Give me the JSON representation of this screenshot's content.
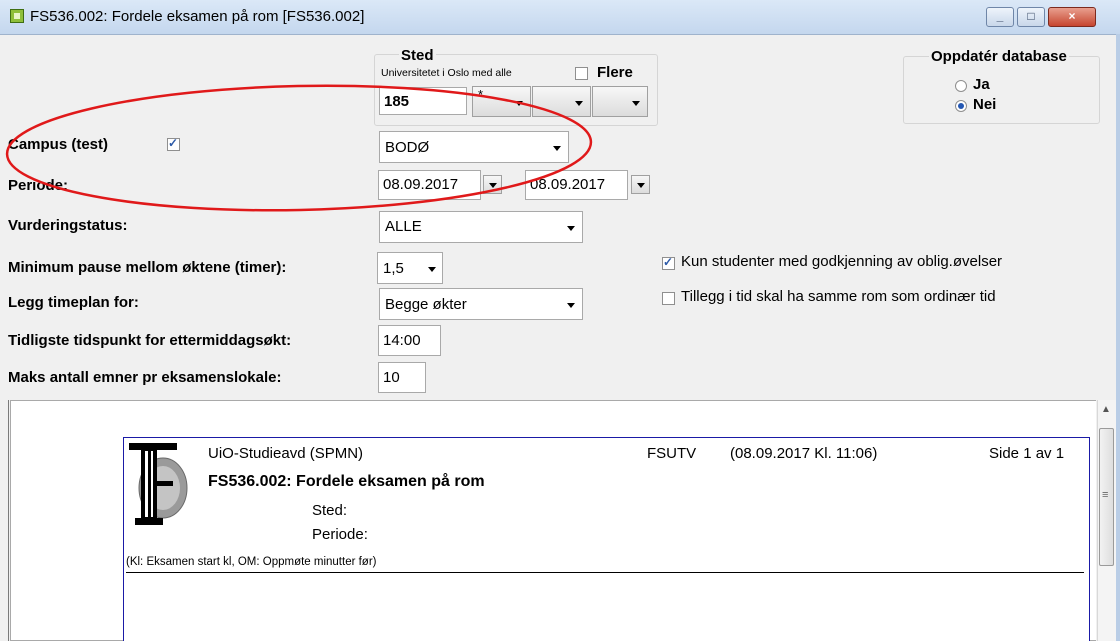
{
  "window": {
    "title": "FS536.002: Fordele eksamen på rom  [FS536.002]"
  },
  "controls": {
    "minimize": "_",
    "maximize": "□",
    "close": "×"
  },
  "sted": {
    "label": "Sted",
    "sublabel": "Universitetet i Oslo med alle",
    "flere_label": "Flere",
    "code": "185",
    "dropdown1": "*"
  },
  "db": {
    "title": "Oppdatér database",
    "ja": "Ja",
    "nei": "Nei",
    "selected": "Nei"
  },
  "form": {
    "campus_label": "Campus (test)",
    "campus_value": "BODØ",
    "periode_label": "Periode:",
    "periode_from": "08.09.2017",
    "periode_to": "08.09.2017",
    "vurdering_label": "Vurderingstatus:",
    "vurdering_value": "ALLE",
    "minpause_label": "Minimum pause mellom øktene (timer):",
    "minpause_value": "1,5",
    "timeplan_label": "Legg timeplan for:",
    "timeplan_value": "Begge økter",
    "tidligste_label": "Tidligste tidspunkt for ettermiddagsøkt:",
    "tidligste_value": "14:00",
    "maks_label": "Maks antall emner pr eksamenslokale:",
    "maks_value": "10"
  },
  "options": {
    "godkjenning": "Kun studenter med godkjenning av oblig.øvelser",
    "tillegg": "Tillegg i tid skal ha samme rom som ordinær tid"
  },
  "report": {
    "org": "UiO-Studieavd (SPMN)",
    "system": "FSUTV",
    "datetime": "(08.09.2017 Kl. 11:06)",
    "page": "Side 1 av 1",
    "title": "FS536.002: Fordele eksamen på rom",
    "sted": "Sted:",
    "periode": "Periode:",
    "note": "(Kl: Eksamen start kl, OM: Oppmøte minutter før)",
    "logo_letters": "F"
  },
  "colors": {
    "annotation": "#e0191a",
    "page_border": "#1a1aa6"
  }
}
